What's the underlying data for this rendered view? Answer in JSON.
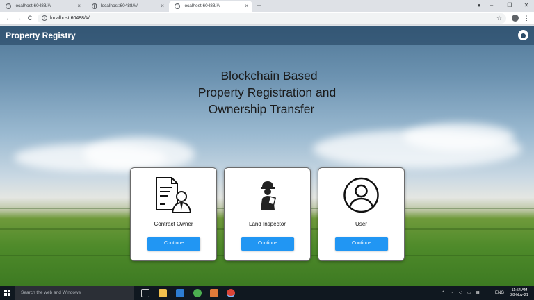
{
  "browser": {
    "tabs": [
      {
        "title": "localhost:60488/#/",
        "active": false
      },
      {
        "title": "localhost:60488/#/",
        "active": false
      },
      {
        "title": "localhost:60488/#/",
        "active": true
      }
    ],
    "url": "localhost:60488/#/",
    "new_tab_label": "+",
    "tab_close": "×",
    "back_icon": "←",
    "forward_icon": "→",
    "reload_icon": "C",
    "star_icon": "☆",
    "menu_icon": "⋮",
    "window_buttons": {
      "minimize": "–",
      "maximize": "❐",
      "close": "✕"
    }
  },
  "app": {
    "title": "Property Registry",
    "hero_lines": [
      "Blockchain Based",
      "Property Registration and",
      "Ownership Transfer"
    ],
    "cards": [
      {
        "role": "Contract Owner",
        "button": "Continue",
        "icon": "contract-document-icon"
      },
      {
        "role": "Land Inspector",
        "button": "Continue",
        "icon": "inspector-icon"
      },
      {
        "role": "User",
        "button": "Continue",
        "icon": "user-circle-icon"
      }
    ],
    "button_color": "#2196f3"
  },
  "taskbar": {
    "search_placeholder": "Search the web and Windows",
    "language": "ENG",
    "time": "11:54 AM",
    "date": "28-Nov-21",
    "tray_arrow": "^"
  }
}
